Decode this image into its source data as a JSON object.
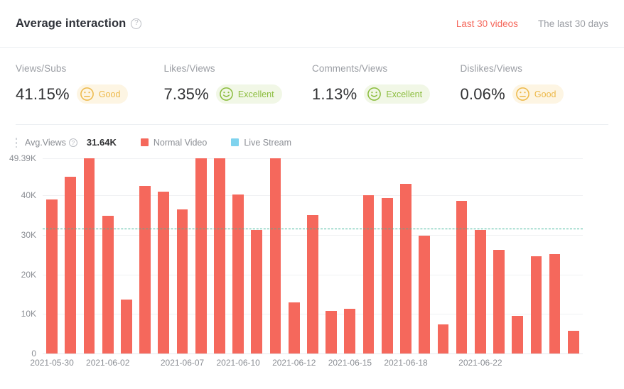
{
  "header": {
    "title": "Average interaction",
    "help_icon": "question-circle-icon",
    "tabs": [
      {
        "label": "Last 30 videos",
        "active": true
      },
      {
        "label": "The last 30 days",
        "active": false
      }
    ]
  },
  "metrics": [
    {
      "label": "Views/Subs",
      "value": "41.15%",
      "rating": "Good",
      "rating_kind": "good",
      "face_icon": "neutral-face-icon",
      "color": "#edb94a"
    },
    {
      "label": "Likes/Views",
      "value": "7.35%",
      "rating": "Excellent",
      "rating_kind": "excellent",
      "face_icon": "smiley-face-icon",
      "color": "#8cbd3f"
    },
    {
      "label": "Comments/Views",
      "value": "1.13%",
      "rating": "Excellent",
      "rating_kind": "excellent",
      "face_icon": "smiley-face-icon",
      "color": "#8cbd3f"
    },
    {
      "label": "Dislikes/Views",
      "value": "0.06%",
      "rating": "Good",
      "rating_kind": "good",
      "face_icon": "neutral-face-icon",
      "color": "#edb94a"
    }
  ],
  "legend": {
    "avg_label": "Avg.Views",
    "avg_help_icon": "question-circle-icon",
    "avg_value": "31.64K",
    "series": [
      {
        "label": "Normal Video",
        "color": "#f5685c"
      },
      {
        "label": "Live Stream",
        "color": "#7fd3ee"
      }
    ]
  },
  "chart_data": {
    "type": "bar",
    "title": "",
    "xlabel": "",
    "ylabel": "",
    "ylim": [
      0,
      49390
    ],
    "grid": true,
    "legend_position": "top-left",
    "bar_color": "#f5685c",
    "average_line": {
      "label": "Avg.Views",
      "value": 31640,
      "color": "#3fb59b",
      "style": "dashed"
    },
    "ytick_labels": [
      "0",
      "10K",
      "20K",
      "30K",
      "40K",
      "49.39K"
    ],
    "ytick_values": [
      0,
      10000,
      20000,
      30000,
      40000,
      49390
    ],
    "xtick_labels": [
      "2021-05-30",
      "2021-06-02",
      "2021-06-07",
      "2021-06-10",
      "2021-06-12",
      "2021-06-15",
      "2021-06-18",
      "2021-06-22"
    ],
    "xtick_indices": [
      0,
      3,
      7,
      10,
      13,
      16,
      19,
      23
    ],
    "series": [
      {
        "name": "Normal Video",
        "values": [
          38900,
          44700,
          49390,
          34900,
          13700,
          42300,
          40900,
          36500,
          49390,
          49390,
          40300,
          31300,
          49390,
          13000,
          35000,
          10700,
          11300,
          40100,
          39400,
          42900,
          29900,
          7400,
          38600,
          31200,
          26200,
          9600,
          24600,
          25100,
          5700
        ]
      }
    ]
  }
}
